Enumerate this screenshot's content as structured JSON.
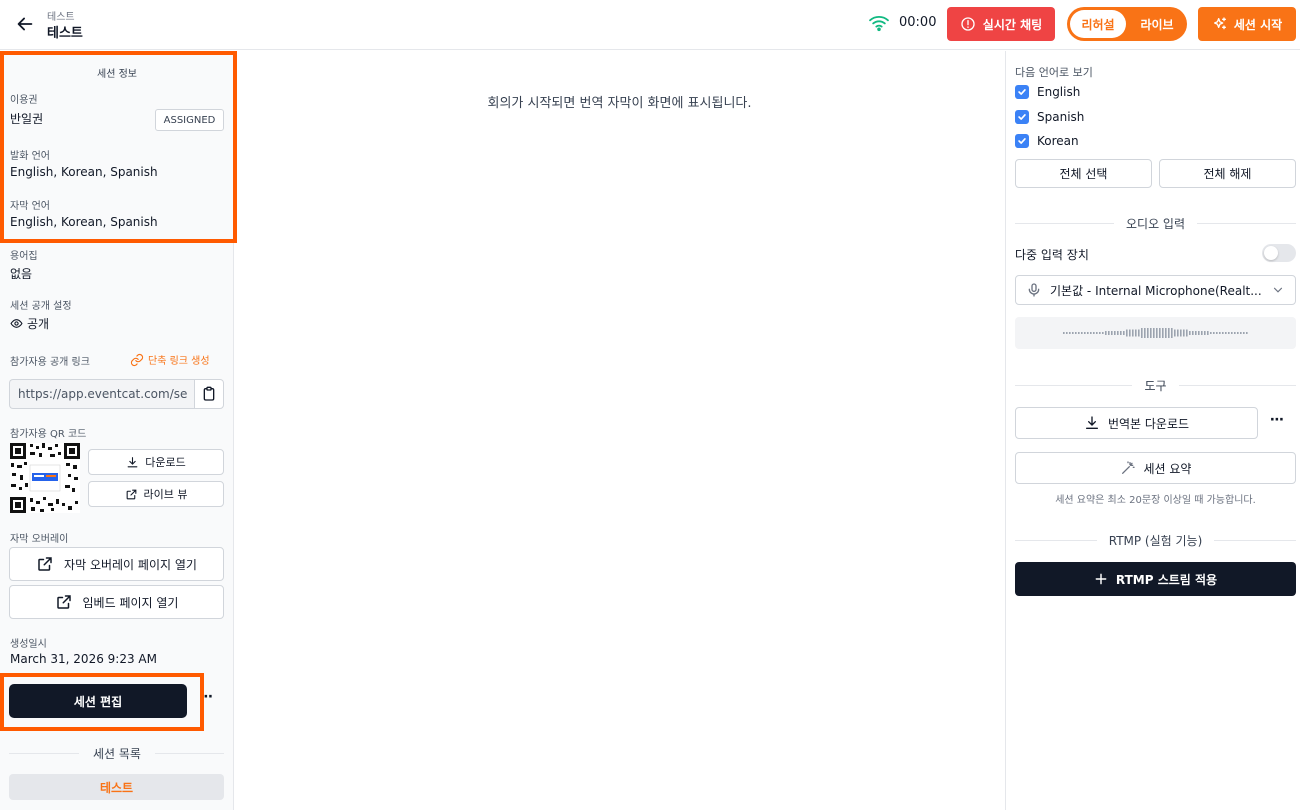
{
  "header": {
    "breadcrumb": "테스트",
    "title": "테스트",
    "timer": "00:00",
    "chat_button": "실시간 채팅",
    "mode_rehearsal": "리허설",
    "mode_live": "라이브",
    "start_button": "세션 시작"
  },
  "left": {
    "section_title": "세션 정보",
    "license_label": "이용권",
    "license_value": "반일권",
    "license_badge": "ASSIGNED",
    "speech_lang_label": "발화 언어",
    "speech_lang_value": "English, Korean, Spanish",
    "subtitle_lang_label": "자막 언어",
    "subtitle_lang_value": "English, Korean, Spanish",
    "glossary_label": "용어집",
    "glossary_value": "없음",
    "visibility_label": "세션 공개 설정",
    "visibility_value": "공개",
    "link_label": "참가자용 공개 링크",
    "short_link": "단축 링크 생성",
    "link_url": "https://app.eventcat.com/se",
    "qr_label": "참가자용 QR 코드",
    "qr_download": "다운로드",
    "qr_live_view": "라이브 뷰",
    "overlay_label": "자막 오버레이",
    "overlay_open": "자막 오버레이 페이지 열기",
    "embed_open": "임베드 페이지 열기",
    "created_label": "생성일시",
    "created_value": "March 31, 2026 9:23 AM",
    "edit_button": "세션 편집",
    "list_title": "세션 목록",
    "list_items": [
      "테스트"
    ]
  },
  "center": {
    "message": "회의가 시작되면 번역 자막이 화면에 표시됩니다."
  },
  "right": {
    "view_lang_label": "다음 언어로 보기",
    "languages": [
      {
        "name": "English",
        "checked": true
      },
      {
        "name": "Spanish",
        "checked": true
      },
      {
        "name": "Korean",
        "checked": true
      }
    ],
    "select_all": "전체 선택",
    "deselect_all": "전체 해제",
    "audio_title": "오디오 입력",
    "multi_device_label": "다중 입력 장치",
    "multi_device_on": false,
    "device_value": "기본값 - Internal Microphone(Realt...",
    "tools_title": "도구",
    "download_transcript": "번역본 다운로드",
    "summary_button": "세션 요약",
    "summary_note": "세션 요약은 최소 20문장 이상일 때 가능합니다.",
    "rtmp_title": "RTMP (실험 기능)",
    "rtmp_button": "RTMP 스트림 적용"
  },
  "colors": {
    "accent": "#f97316",
    "danger": "#ef4444",
    "dark": "#111827",
    "highlight": "#ff5a00"
  }
}
